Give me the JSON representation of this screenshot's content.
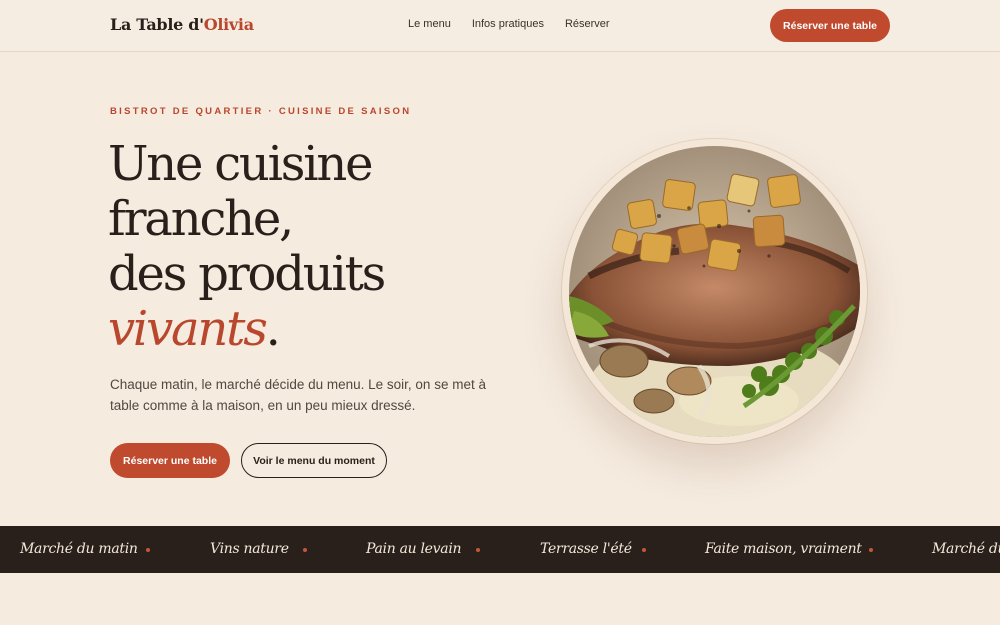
{
  "brand": {
    "name_part1": "La Table d'",
    "name_part2": "Olivia"
  },
  "nav": {
    "items": [
      "Le menu",
      "Infos pratiques",
      "Réserver"
    ]
  },
  "header": {
    "cta_label": "Réserver une table"
  },
  "hero": {
    "eyebrow": "BISTROT DE QUARTIER · CUISINE DE SAISON",
    "headline_lines": [
      "Une cuisine",
      "franche,",
      "des produits"
    ],
    "headline_accent": "vivants",
    "headline_end": ".",
    "lede": "Chaque matin, le marché décide du menu. Le soir, on se met à table comme à la maison, en un peu mieux dressé.",
    "primary_cta": "Réserver une table",
    "secondary_cta": "Voir le menu du moment"
  },
  "ribbon": {
    "items": [
      "Marché du matin",
      "Vins nature",
      "Pain au levain",
      "Terrasse l'été",
      "Faite maison, vraiment",
      "Marché du"
    ]
  },
  "colors": {
    "accent": "#bf4a2e",
    "background": "#f5ebdf",
    "ink": "#2a201b"
  },
  "icons": {
    "plate_image": "dish-photo"
  }
}
